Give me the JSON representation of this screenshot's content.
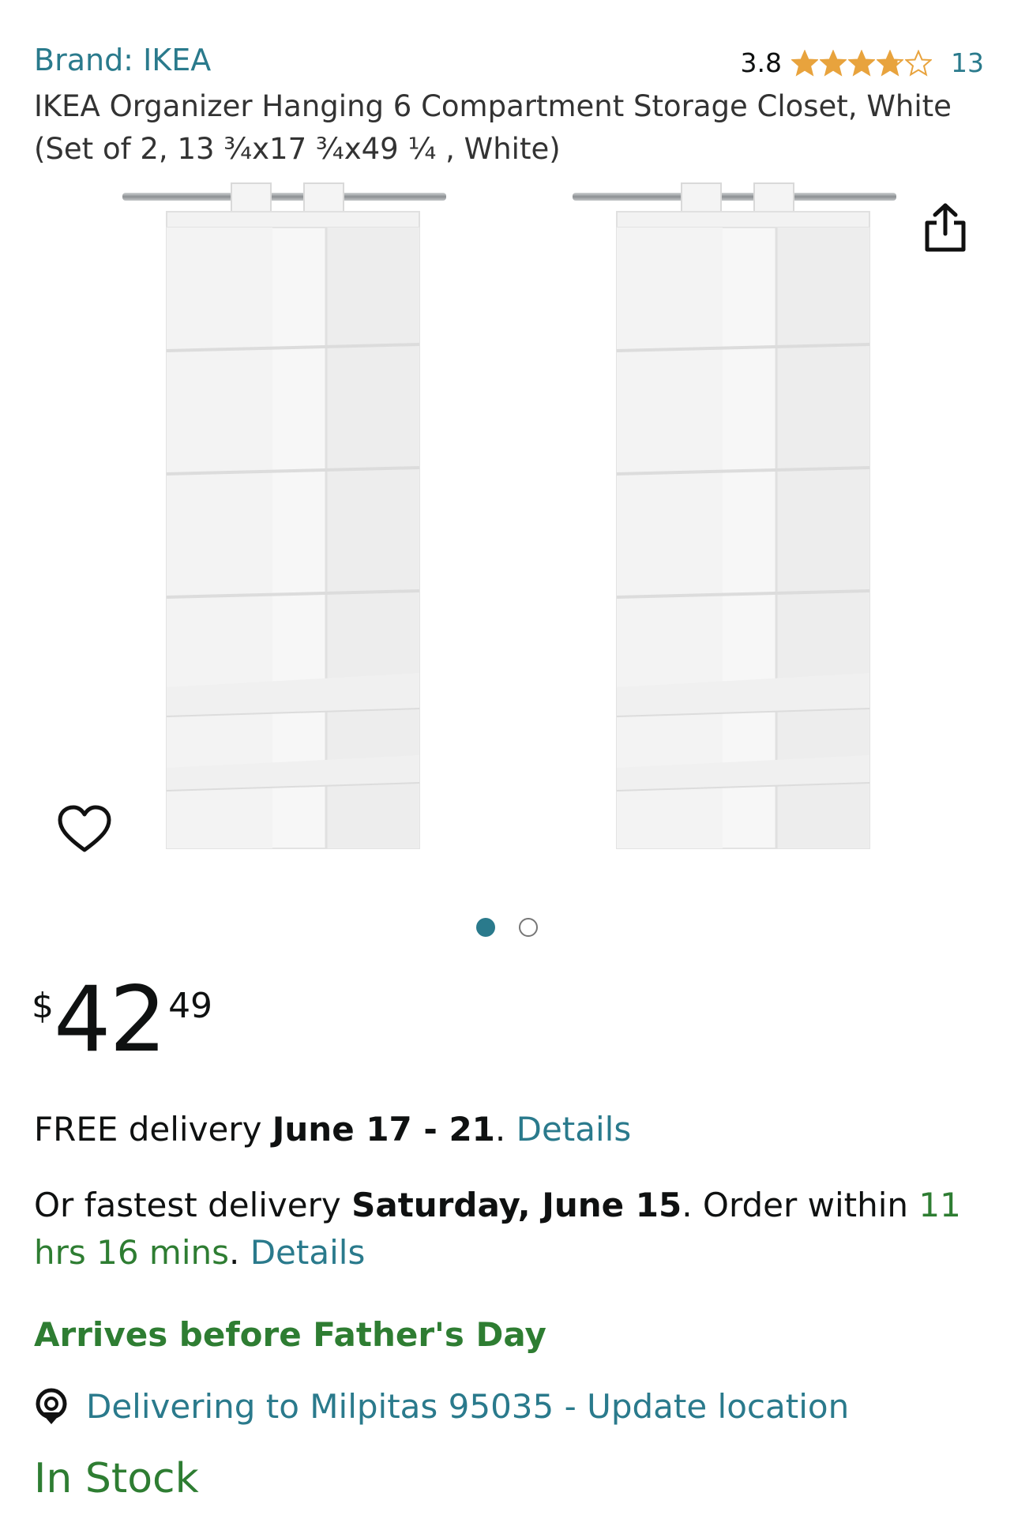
{
  "brand": "Brand: IKEA",
  "rating": {
    "value": "3.8",
    "stars": 3.8,
    "count": "13",
    "star_color": "#e8a33d"
  },
  "title": "IKEA Organizer Hanging 6 Compartment Storage Closet, White (Set of 2, 13 ¾x17 ¾x49 ¼ , White)",
  "gallery": {
    "image_count": 2,
    "active_index": 0,
    "icons": {
      "share": "share-icon",
      "wishlist": "heart-icon"
    }
  },
  "price": {
    "symbol": "$",
    "whole": "42",
    "fraction": "49"
  },
  "delivery": {
    "free_prefix": "FREE delivery ",
    "free_dates": "June 17 - 21",
    "free_dot": ".",
    "free_details": "Details",
    "fast_prefix": "Or fastest delivery ",
    "fast_date": "Saturday, June 15",
    "fast_mid": ". Order within ",
    "fast_countdown": "11 hrs 16 mins",
    "fast_dot": ".",
    "fast_details": "Details"
  },
  "arrives_note": "Arrives before Father's Day",
  "location": {
    "text": "Delivering to Milpitas 95035 - Update location",
    "icon": "location-pin-icon"
  },
  "stock_status": "In Stock",
  "colors": {
    "link": "#2a7a8c",
    "green": "#2e7d32",
    "star": "#e8a33d"
  }
}
